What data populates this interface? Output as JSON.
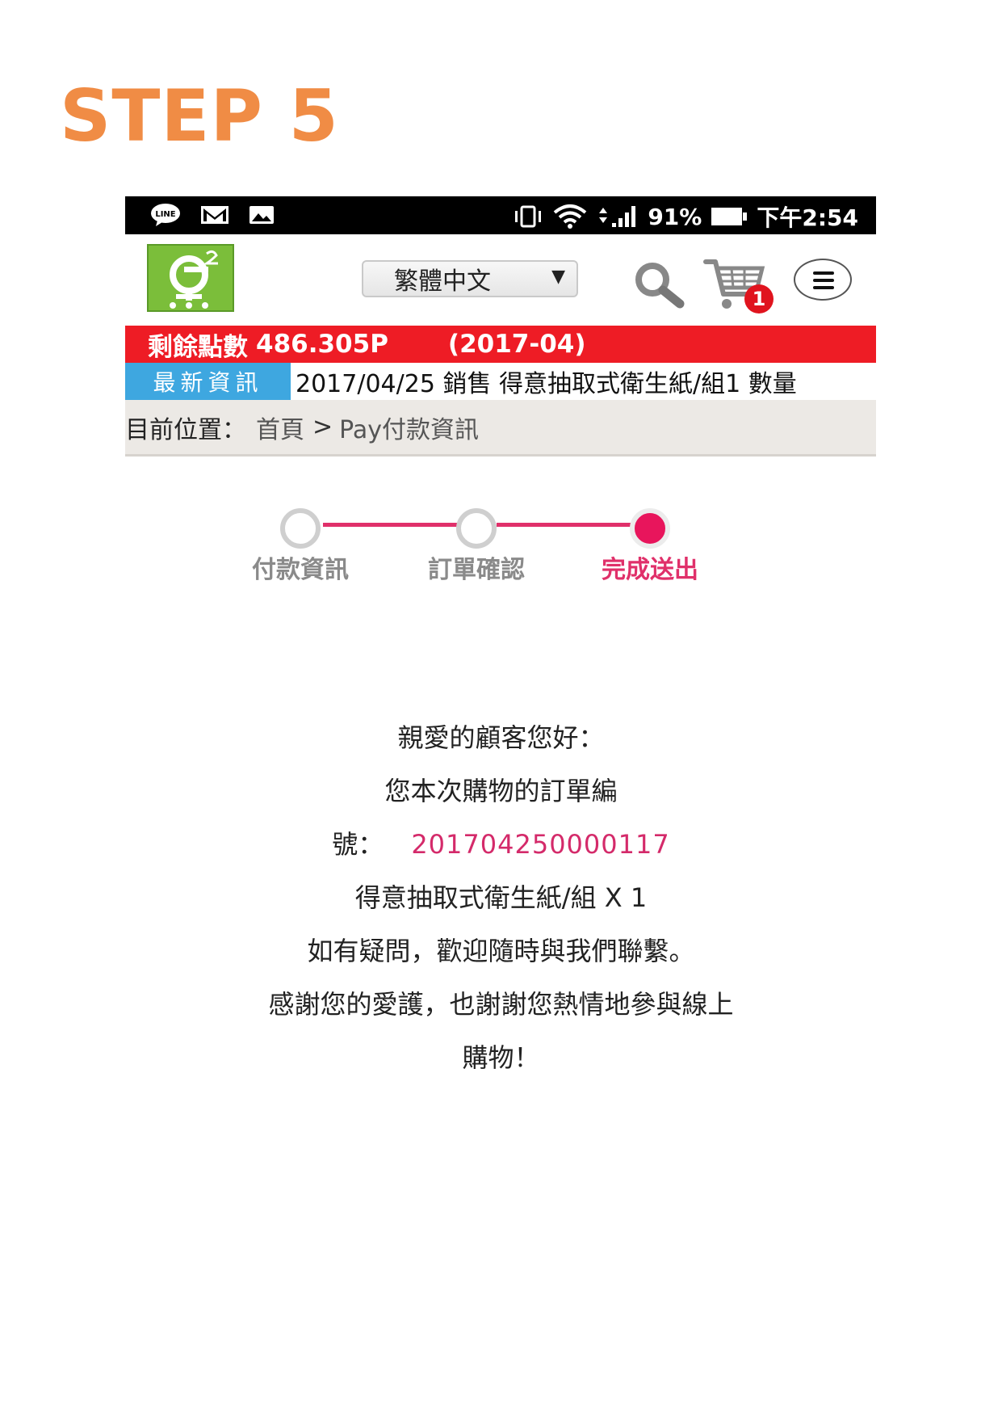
{
  "step_title": "STEP 5",
  "status_bar": {
    "left_icons": [
      "line-app-icon",
      "gmail-icon",
      "gallery-icon"
    ],
    "right_icons": [
      "vibrate-icon",
      "wifi-icon",
      "signal-icon",
      "battery-icon"
    ],
    "battery": "91%",
    "time": "下午2:54"
  },
  "header": {
    "language": "繁體中文",
    "cart_count": "1"
  },
  "points_bar": {
    "label": "剩餘點數",
    "points": "486.305P",
    "period": "(2017-04)"
  },
  "news": {
    "label": "最新資訊",
    "text": "2017/04/25 銷售 得意抽取式衛生紙/組1 數量"
  },
  "breadcrumb": {
    "label": "目前位置：",
    "home": "首頁",
    "separator": ">",
    "current": "Pay付款資訊"
  },
  "stepper": {
    "steps": [
      {
        "label": "付款資訊",
        "state": "done"
      },
      {
        "label": "訂單確認",
        "state": "done"
      },
      {
        "label": "完成送出",
        "state": "active"
      }
    ],
    "line_color": "#E0306A",
    "active_color": "#E8155C"
  },
  "message": {
    "line1": "親愛的顧客您好：",
    "line2": "您本次購物的訂單編",
    "order_label": "號：",
    "order_number": "201704250000117",
    "line4": "得意抽取式衛生紙/組 X 1",
    "line5": "如有疑問，歡迎隨時與我們聯繫。",
    "line6": "感謝您的愛護，也謝謝您熱情地參與線上",
    "line7": "購物！"
  },
  "colors": {
    "step_title": "#F08C45",
    "points_bar": "#EE1C25",
    "news_label": "#3EA7E0",
    "order_number": "#D42A6A"
  }
}
